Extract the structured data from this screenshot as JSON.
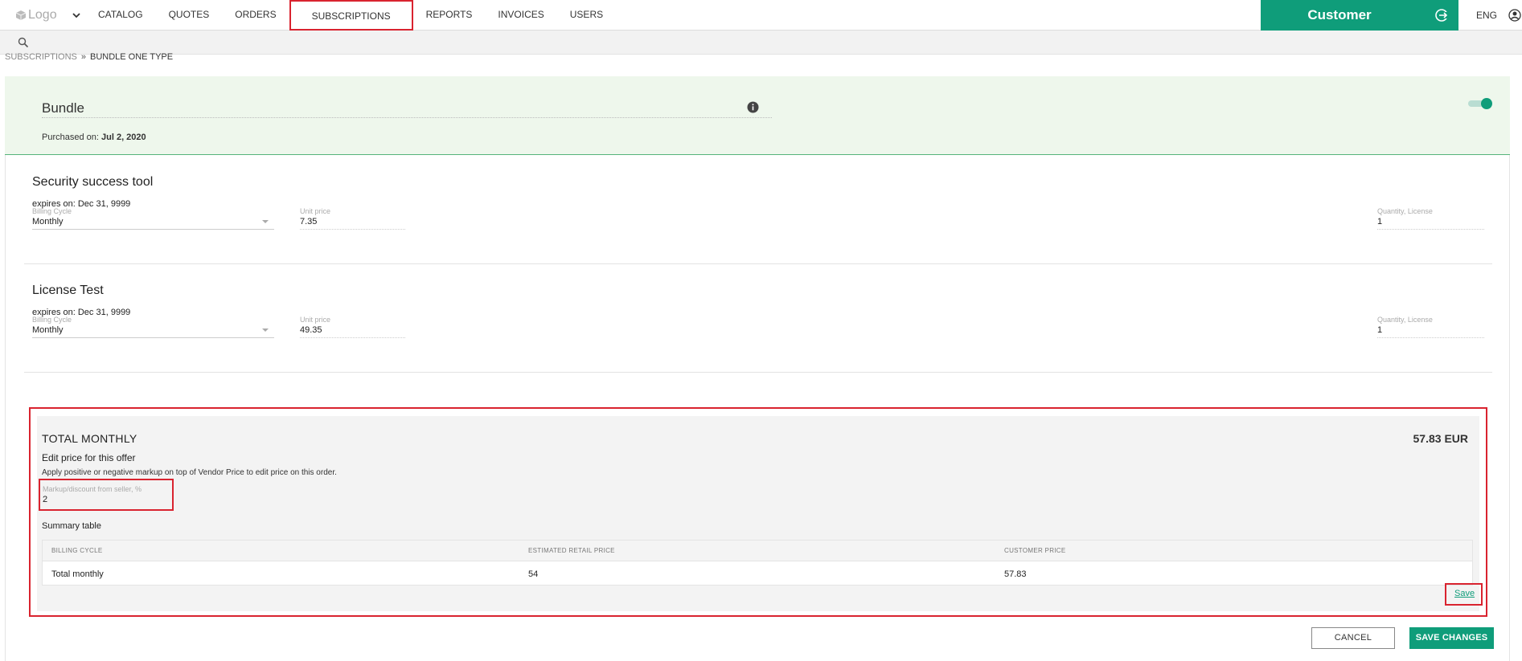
{
  "header": {
    "logo_text": "Logo",
    "nav": [
      "CATALOG",
      "QUOTES",
      "ORDERS",
      "SUBSCRIPTIONS",
      "REPORTS",
      "INVOICES",
      "USERS"
    ],
    "active_nav": "SUBSCRIPTIONS",
    "customer_label": "Customer",
    "language": "ENG",
    "accent_color": "#0f9d7a",
    "highlight_color": "#d9232f"
  },
  "breadcrumb": {
    "parent": "SUBSCRIPTIONS",
    "separator": "»",
    "current": "BUNDLE ONE TYPE"
  },
  "bundle": {
    "title": "Bundle",
    "purchased_label": "Purchased on:",
    "purchased_date": "Jul 2, 2020",
    "toggle_on": true
  },
  "products": [
    {
      "name": "Security success tool",
      "expires": "expires on: Dec 31, 9999",
      "billing_label": "Billing Cycle",
      "billing_value": "Monthly",
      "unit_price_label": "Unit price",
      "unit_price": "7.35",
      "quantity_label": "Quantity, License",
      "quantity": "1"
    },
    {
      "name": "License Test",
      "expires": "expires on: Dec 31, 9999",
      "billing_label": "Billing Cycle",
      "billing_value": "Monthly",
      "unit_price_label": "Unit price",
      "unit_price": "49.35",
      "quantity_label": "Quantity, License",
      "quantity": "1"
    }
  ],
  "total": {
    "title": "TOTAL MONTHLY",
    "amount": "57.83 EUR",
    "edit_heading": "Edit price for this offer",
    "edit_desc": "Apply positive or negative markup on top of Vendor Price to edit price on this order.",
    "markup_label": "Markup/discount from seller, %",
    "markup_value": "2",
    "summary_title": "Summary table",
    "columns": [
      "BILLING CYCLE",
      "ESTIMATED RETAIL PRICE",
      "CUSTOMER PRICE"
    ],
    "row": [
      "Total monthly",
      "54",
      "57.83"
    ],
    "save_link": "Save"
  },
  "actions": {
    "cancel": "CANCEL",
    "save_changes": "SAVE CHANGES"
  },
  "icons": {
    "logo": "cube-icon",
    "menu": "chevron-down-icon",
    "exit": "logout-icon",
    "user": "user-icon",
    "search": "search-icon",
    "info": "info-icon",
    "select": "caret-down-icon"
  }
}
